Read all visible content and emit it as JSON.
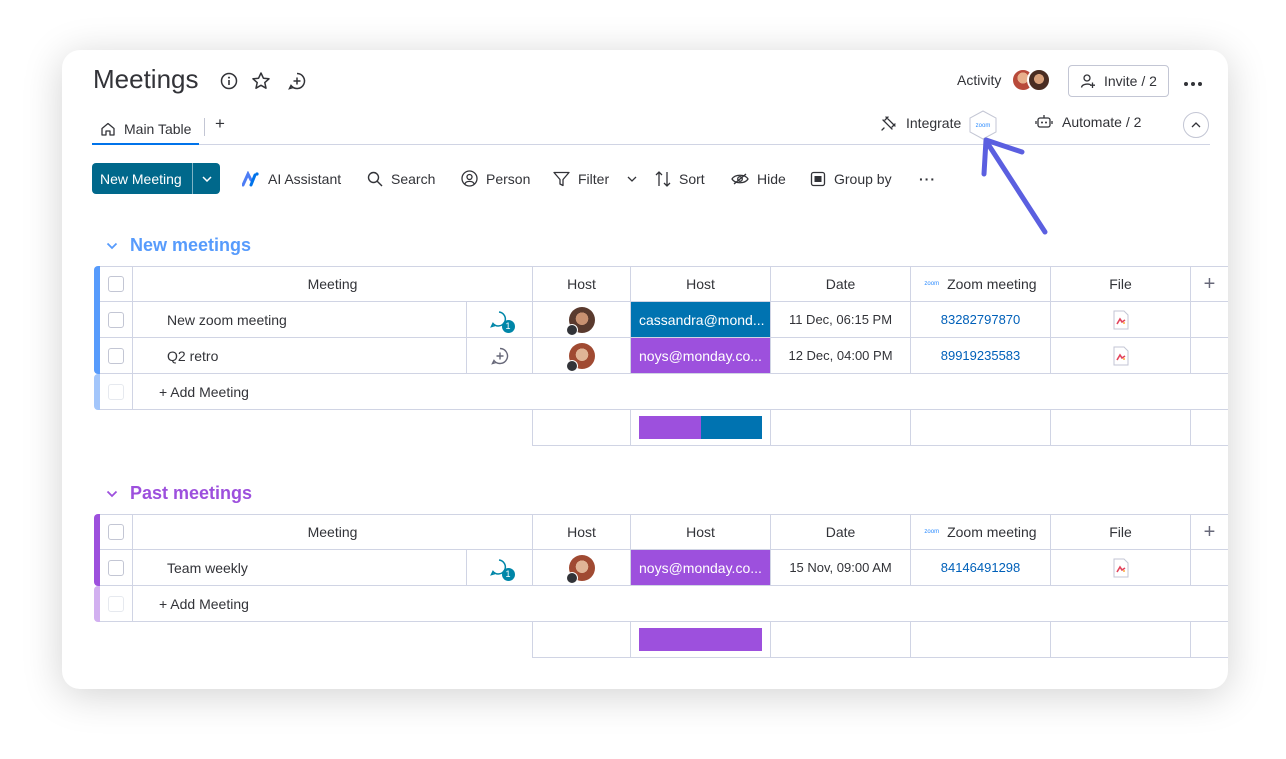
{
  "board": {
    "title": "Meetings",
    "activity_label": "Activity",
    "invite_label": "Invite / 2"
  },
  "tabs": {
    "main_label": "Main Table",
    "add_label": "+",
    "integrate_label": "Integrate",
    "zoom_badge": "zoom",
    "automate_label": "Automate / 2"
  },
  "toolbar": {
    "new_label": "New Meeting",
    "ai_label": "AI Assistant",
    "search_label": "Search",
    "person_label": "Person",
    "filter_label": "Filter",
    "sort_label": "Sort",
    "hide_label": "Hide",
    "group_label": "Group by",
    "more_label": "···"
  },
  "columns": {
    "meeting": "Meeting",
    "host1": "Host",
    "host2": "Host",
    "date": "Date",
    "zoom_mini": "zoom",
    "zoom": "Zoom meeting",
    "file": "File",
    "add": "+"
  },
  "groups": [
    {
      "title": "New meetings",
      "color": "#579bfc",
      "add_label": "+ Add Meeting",
      "rows": [
        {
          "name": "New zoom meeting",
          "updates": "1",
          "email": "cassandra@mond...",
          "email_color": "#0073b1",
          "date": "11 Dec, 06:15 PM",
          "zoom_id": "83282797870"
        },
        {
          "name": "Q2 retro",
          "updates": "",
          "email": "noys@monday.co...",
          "email_color": "#9d50dd",
          "date": "12 Dec, 04:00 PM",
          "zoom_id": "89919235583"
        }
      ]
    },
    {
      "title": "Past meetings",
      "color": "#9d50dd",
      "add_label": "+ Add Meeting",
      "rows": [
        {
          "name": "Team weekly",
          "updates": "1",
          "email": "noys@monday.co...",
          "email_color": "#9d50dd",
          "date": "15 Nov, 09:00 AM",
          "zoom_id": "84146491298"
        }
      ]
    }
  ]
}
